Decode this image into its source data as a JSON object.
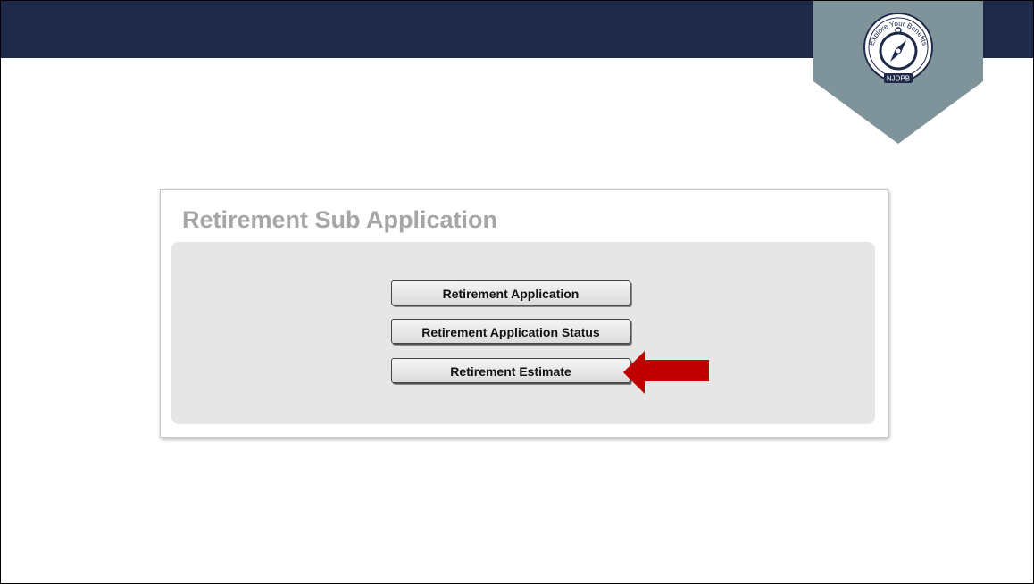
{
  "panel": {
    "title": "Retirement Sub Application"
  },
  "menu": {
    "items": [
      {
        "label": "Retirement Application"
      },
      {
        "label": "Retirement Application Status"
      },
      {
        "label": "Retirement Estimate"
      }
    ]
  },
  "badge": {
    "text_top": "Explore Your Benefits",
    "text_bottom": "NJDPB"
  },
  "colors": {
    "top_bar": "#1f2a4a",
    "badge_fill": "#7f939b",
    "arrow": "#c00000",
    "panel_title": "#a6a6a6",
    "panel_inner": "#e6e6e6"
  }
}
